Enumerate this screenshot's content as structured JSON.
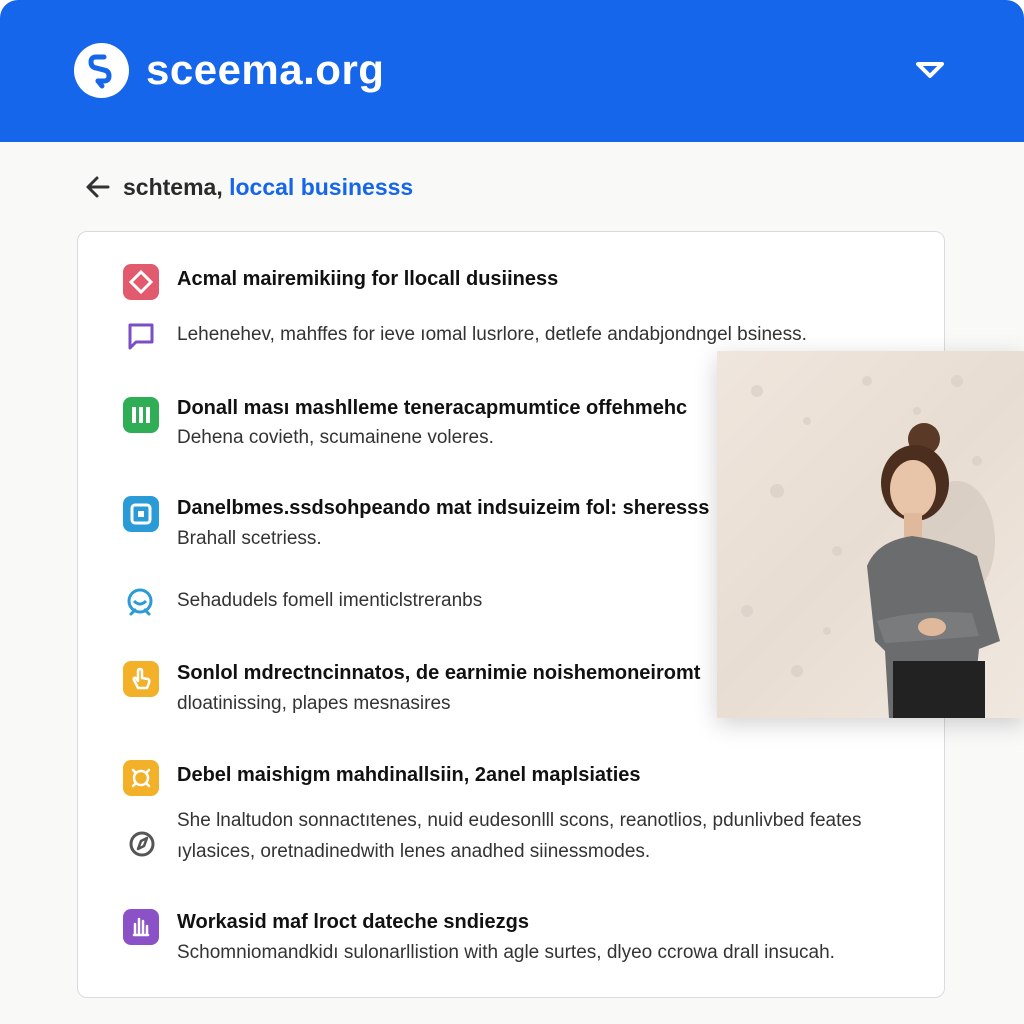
{
  "header": {
    "site_name": "sceema.org",
    "logo_icon": "schema-logo-icon",
    "menu_icon": "chevron-down-icon",
    "background": "#1566ea"
  },
  "breadcrumb": {
    "back_icon": "arrow-left-icon",
    "root": "schtema,",
    "current": "loccal businesss"
  },
  "items": [
    {
      "icon": "diamond-icon",
      "icon_color": "#e25a6e",
      "title": "Acmal mairemikiing for llocall dusiiness"
    },
    {
      "icon": "chat-bubble-icon",
      "icon_color": "#7a4fc4",
      "body": "Lehenehev, mahffes for ieve ıomal lusrlore, detlefe andabjondngel bsiness."
    },
    {
      "icon": "columns-icon",
      "icon_color": "#2fae55",
      "title": "Donall ması mashlleme teneracapmumtice offehmehc",
      "body": "Dehena covieth, scumainene voleres."
    },
    {
      "icon": "square-frame-icon",
      "icon_color": "#2a9bd6",
      "title": "Danelbmes.ssdsohpeando mat indsuizeim fol: sheresss",
      "body": "Brahall scetriess."
    },
    {
      "icon": "support-agent-icon",
      "icon_color": "#2a9bd6",
      "body": "Sehadudels fomell imenticlstreranbs"
    },
    {
      "icon": "pointer-hand-icon",
      "icon_color": "#f2b128",
      "title": "Sonlol mdrectncinnatos, de earnimie noishemoneiromt",
      "body": "dloatinissing, plapes mesnasires"
    },
    {
      "icon": "sparkle-icon",
      "icon_color": "#f2b128",
      "title": "Debel maishigm mahdinallsiin, 2anel maplsiaties",
      "body": "She lnaltudon sonnactıtenes, nuid eudesonlll scons, reanotlios, pdunlivbed feates"
    },
    {
      "icon": "compass-icon",
      "icon_color": "#555555",
      "body": "ıylasices, oretnadinedwith lenes anadhed siinessmodes."
    },
    {
      "icon": "hand-icon",
      "icon_color": "#8a52c6",
      "title": "Workasid maf lroct dateche sndiezgs",
      "body": "Schomniomandkidı sulonarllistion with agle surtes, dlyeo ccrowa drall insucah."
    }
  ],
  "photo": {
    "subject": "person-photo"
  }
}
